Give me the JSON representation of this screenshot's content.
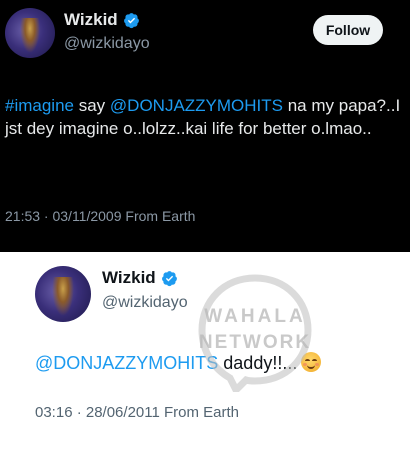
{
  "tweet_dark": {
    "name": "Wizkid",
    "handle": "@wizkidayo",
    "follow_label": "Follow",
    "text_parts": [
      "#imagine",
      " say ",
      "@DONJAZZYMOHITS",
      " na my papa?..I jst dey imagine o..lolzz..kai life for better o.lmao.."
    ],
    "meta": "21:53 · 03/11/2009 From Earth"
  },
  "tweet_light": {
    "name": "Wizkid",
    "handle": "@wizkidayo",
    "text_parts": [
      "@DONJAZZYMOHITS",
      " daddy!!..."
    ],
    "meta": "03:16 · 28/06/2011 From Earth"
  },
  "watermark": {
    "line1": "WAHALA",
    "line2": "NETWORK"
  },
  "colors": {
    "link": "#1d9bf0",
    "verified": "#1d9bf0",
    "dark_bg": "#000000",
    "light_bg": "#ffffff"
  },
  "icons": {
    "verified": "verified-badge-icon",
    "emoji": "smiling-face-with-blush-emoji"
  }
}
